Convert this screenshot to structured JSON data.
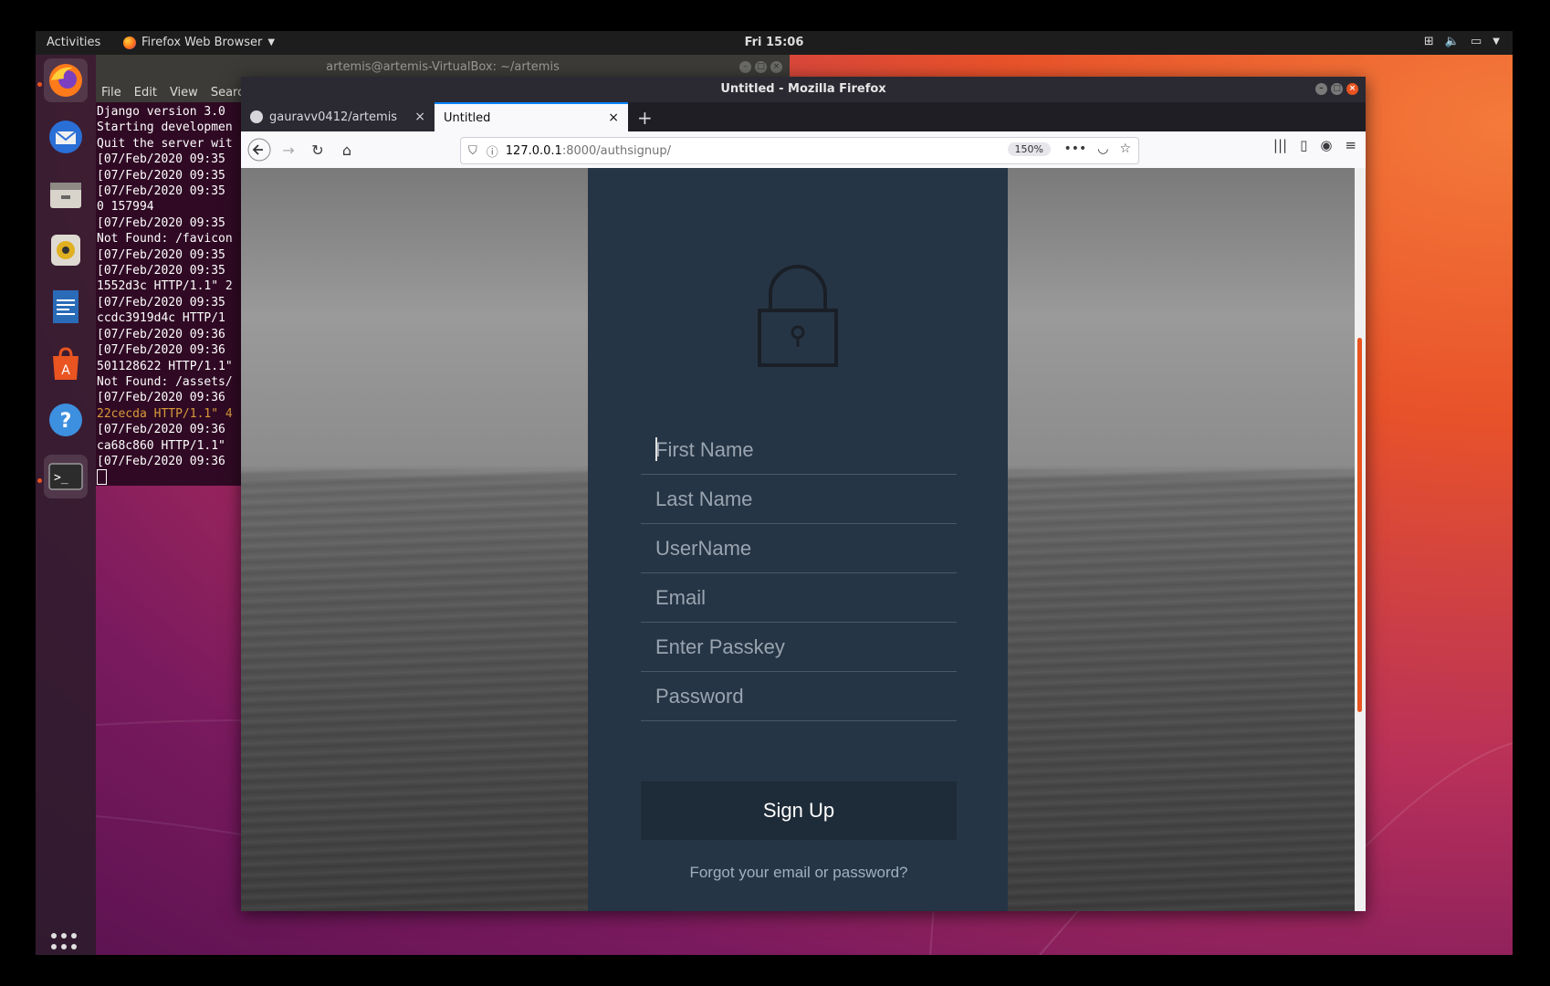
{
  "topbar": {
    "activities": "Activities",
    "app_name": "Firefox Web Browser",
    "clock": "Fri 15:06"
  },
  "dock": {
    "items": [
      "firefox-icon",
      "thunderbird-icon",
      "files-icon",
      "rhythmbox-icon",
      "libreoffice-writer-icon",
      "software-icon",
      "help-icon",
      "terminal-icon"
    ]
  },
  "terminal": {
    "title": "artemis@artemis-VirtualBox: ~/artemis",
    "menu": [
      "File",
      "Edit",
      "View",
      "Search"
    ],
    "lines": [
      "Django version 3.0",
      "Starting developmen",
      "Quit the server wit",
      "[07/Feb/2020 09:35",
      "[07/Feb/2020 09:35",
      "[07/Feb/2020 09:35",
      "0 157994",
      "[07/Feb/2020 09:35",
      "Not Found: /favicon",
      "[07/Feb/2020 09:35",
      "[07/Feb/2020 09:35",
      "1552d3c HTTP/1.1\" 2",
      "[07/Feb/2020 09:35",
      "ccdc3919d4c HTTP/1",
      "[07/Feb/2020 09:36",
      "[07/Feb/2020 09:36",
      "501128622 HTTP/1.1\"",
      "Not Found: /assets/",
      "[07/Feb/2020 09:36"
    ],
    "orange_line": "22cecda HTTP/1.1\" 4",
    "lines_after": [
      "[07/Feb/2020 09:36",
      "ca68c860 HTTP/1.1\"",
      "[07/Feb/2020 09:36"
    ]
  },
  "firefox": {
    "title": "Untitled - Mozilla Firefox",
    "tabs": [
      {
        "label": "gauravv0412/artemis",
        "active": false
      },
      {
        "label": "Untitled",
        "active": true
      }
    ],
    "url_host": "127.0.0.1",
    "url_rest": ":8000/authsignup/",
    "zoom": "150%"
  },
  "page": {
    "fields": [
      {
        "placeholder": "First Name"
      },
      {
        "placeholder": "Last Name"
      },
      {
        "placeholder": "UserName"
      },
      {
        "placeholder": "Email"
      },
      {
        "placeholder": "Enter Passkey"
      },
      {
        "placeholder": "Password"
      }
    ],
    "signup_label": "Sign Up",
    "forgot_link": "Forgot your email or password?"
  },
  "colors": {
    "panel": "#263545",
    "accent": "#e95420",
    "tab_highlight": "#0a84ff"
  }
}
